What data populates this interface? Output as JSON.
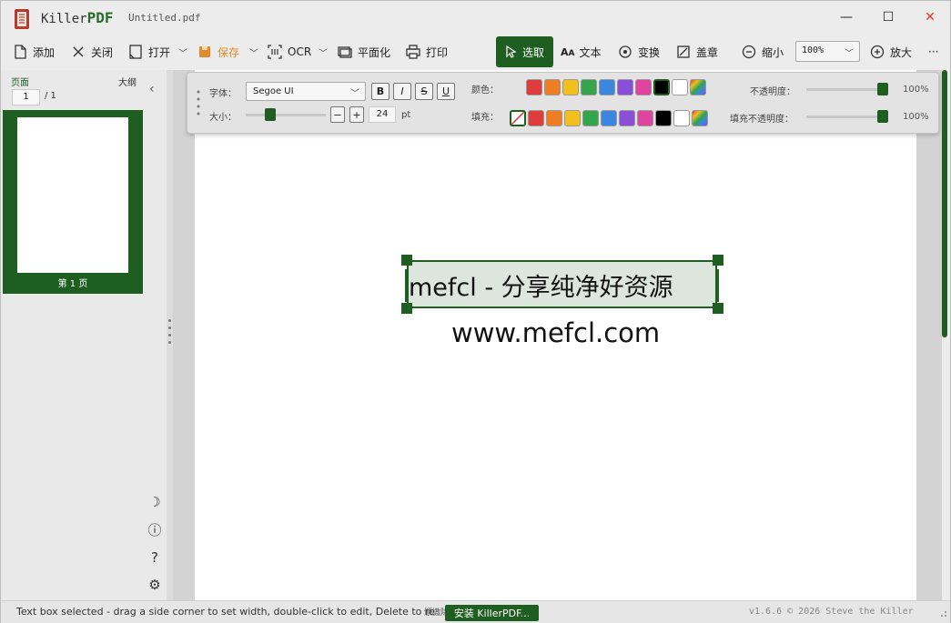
{
  "titlebar": {
    "app_name_prefix": "Killer",
    "app_name_suffix": "PDF",
    "document_title": "Untitled.pdf",
    "minimize": "—",
    "maximize": "☐",
    "close": "✕"
  },
  "toolbar": {
    "add": "添加",
    "close": "关闭",
    "open": "打开",
    "save": "保存",
    "ocr": "OCR",
    "flatten": "平面化",
    "print": "打印",
    "select": "选取",
    "text": "文本",
    "transform": "变换",
    "stamp": "盖章",
    "zoom_out": "缩小",
    "zoom_value": "100%",
    "zoom_in": "放大",
    "more": "···"
  },
  "sidebar": {
    "tab_pages": "页面",
    "tab_outline": "大纲",
    "current_page": "1",
    "page_total": "/ 1",
    "thumb_label": "第 1 页"
  },
  "props": {
    "font_label": "字体：",
    "font_value": "Segoe UI",
    "bold": "B",
    "italic": "I",
    "strike": "S",
    "underline": "U",
    "size_label": "大小：",
    "size_minus": "−",
    "size_plus": "+",
    "size_value": "24",
    "size_unit": "pt",
    "size_slider_fraction": 0.28,
    "color_label": "颜色：",
    "fill_label": "填充：",
    "opacity_label": "不透明度：",
    "opacity_value": "100%",
    "fill_opacity_label": "填充不透明度：",
    "fill_opacity_value": "100%",
    "colors": [
      "#e03b3b",
      "#ef7d22",
      "#f2bf1f",
      "#34a54a",
      "#3a86e0",
      "#8a4fd6",
      "#e0449e",
      "#000000",
      "#ffffff"
    ],
    "selected_color": "#000000"
  },
  "document": {
    "textbox_text": "mefcl - 分享纯净好资源",
    "url_text": "www.mefcl.com"
  },
  "statusbar": {
    "message": "Text box selected - drag a side corner to set width, double-click to edit, Delete to re",
    "overlap_text": "頒謸除",
    "install_button": "安装 KillerPDF...",
    "version": "v1.6.6  © 2026  Steve the Killer"
  },
  "side_icons": {
    "theme": "☽",
    "info": "ⓘ",
    "help": "?",
    "settings": "⚙"
  }
}
